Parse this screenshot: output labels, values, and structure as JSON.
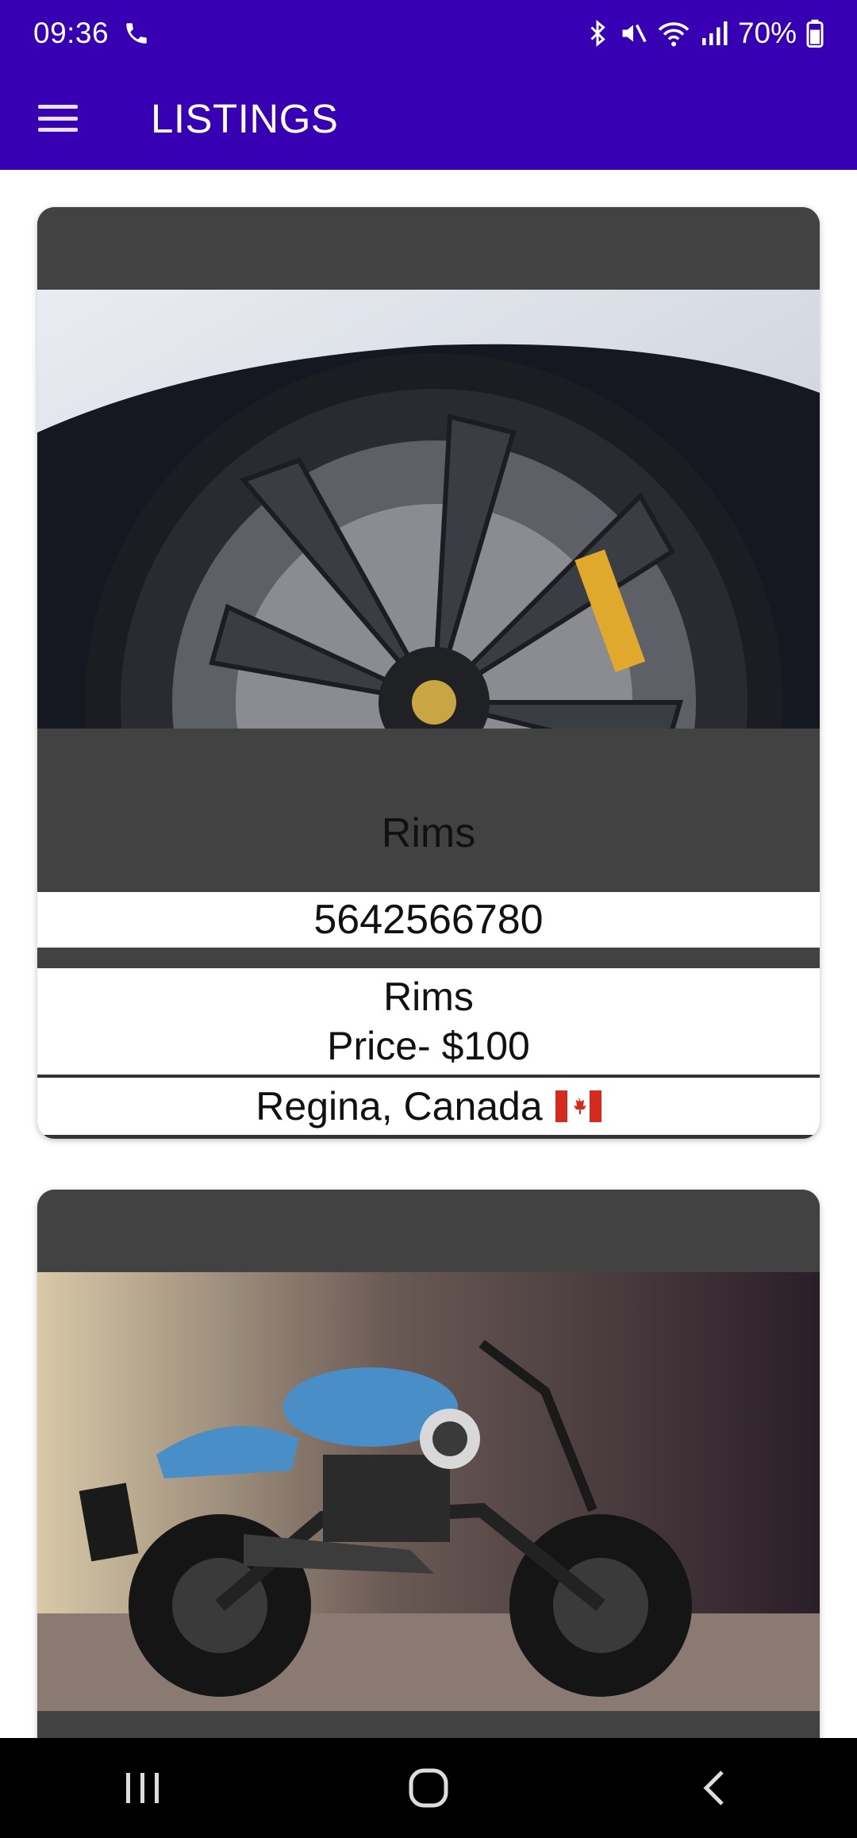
{
  "status_bar": {
    "time": "09:36",
    "battery": "70%",
    "icons": [
      "phone-icon",
      "bluetooth-icon",
      "mute-icon",
      "wifi-icon",
      "signal-icon",
      "battery-icon"
    ]
  },
  "app_bar": {
    "title": "LISTINGS",
    "menu_icon": "hamburger-menu-icon",
    "color": "#3700b3"
  },
  "listings": [
    {
      "image": "wheel-rim-photo",
      "name": "Rims",
      "phone": "5642566780",
      "description_title": "Rims",
      "price": "Price- $100",
      "location": "Regina, Canada",
      "flag": "canada-flag-icon"
    },
    {
      "image": "motorcycle-photo"
    }
  ],
  "nav_bar": {
    "icons": [
      "recent-apps-icon",
      "home-icon",
      "back-icon"
    ]
  },
  "colors": {
    "card_background": "#424242",
    "primary": "#3700b3"
  }
}
